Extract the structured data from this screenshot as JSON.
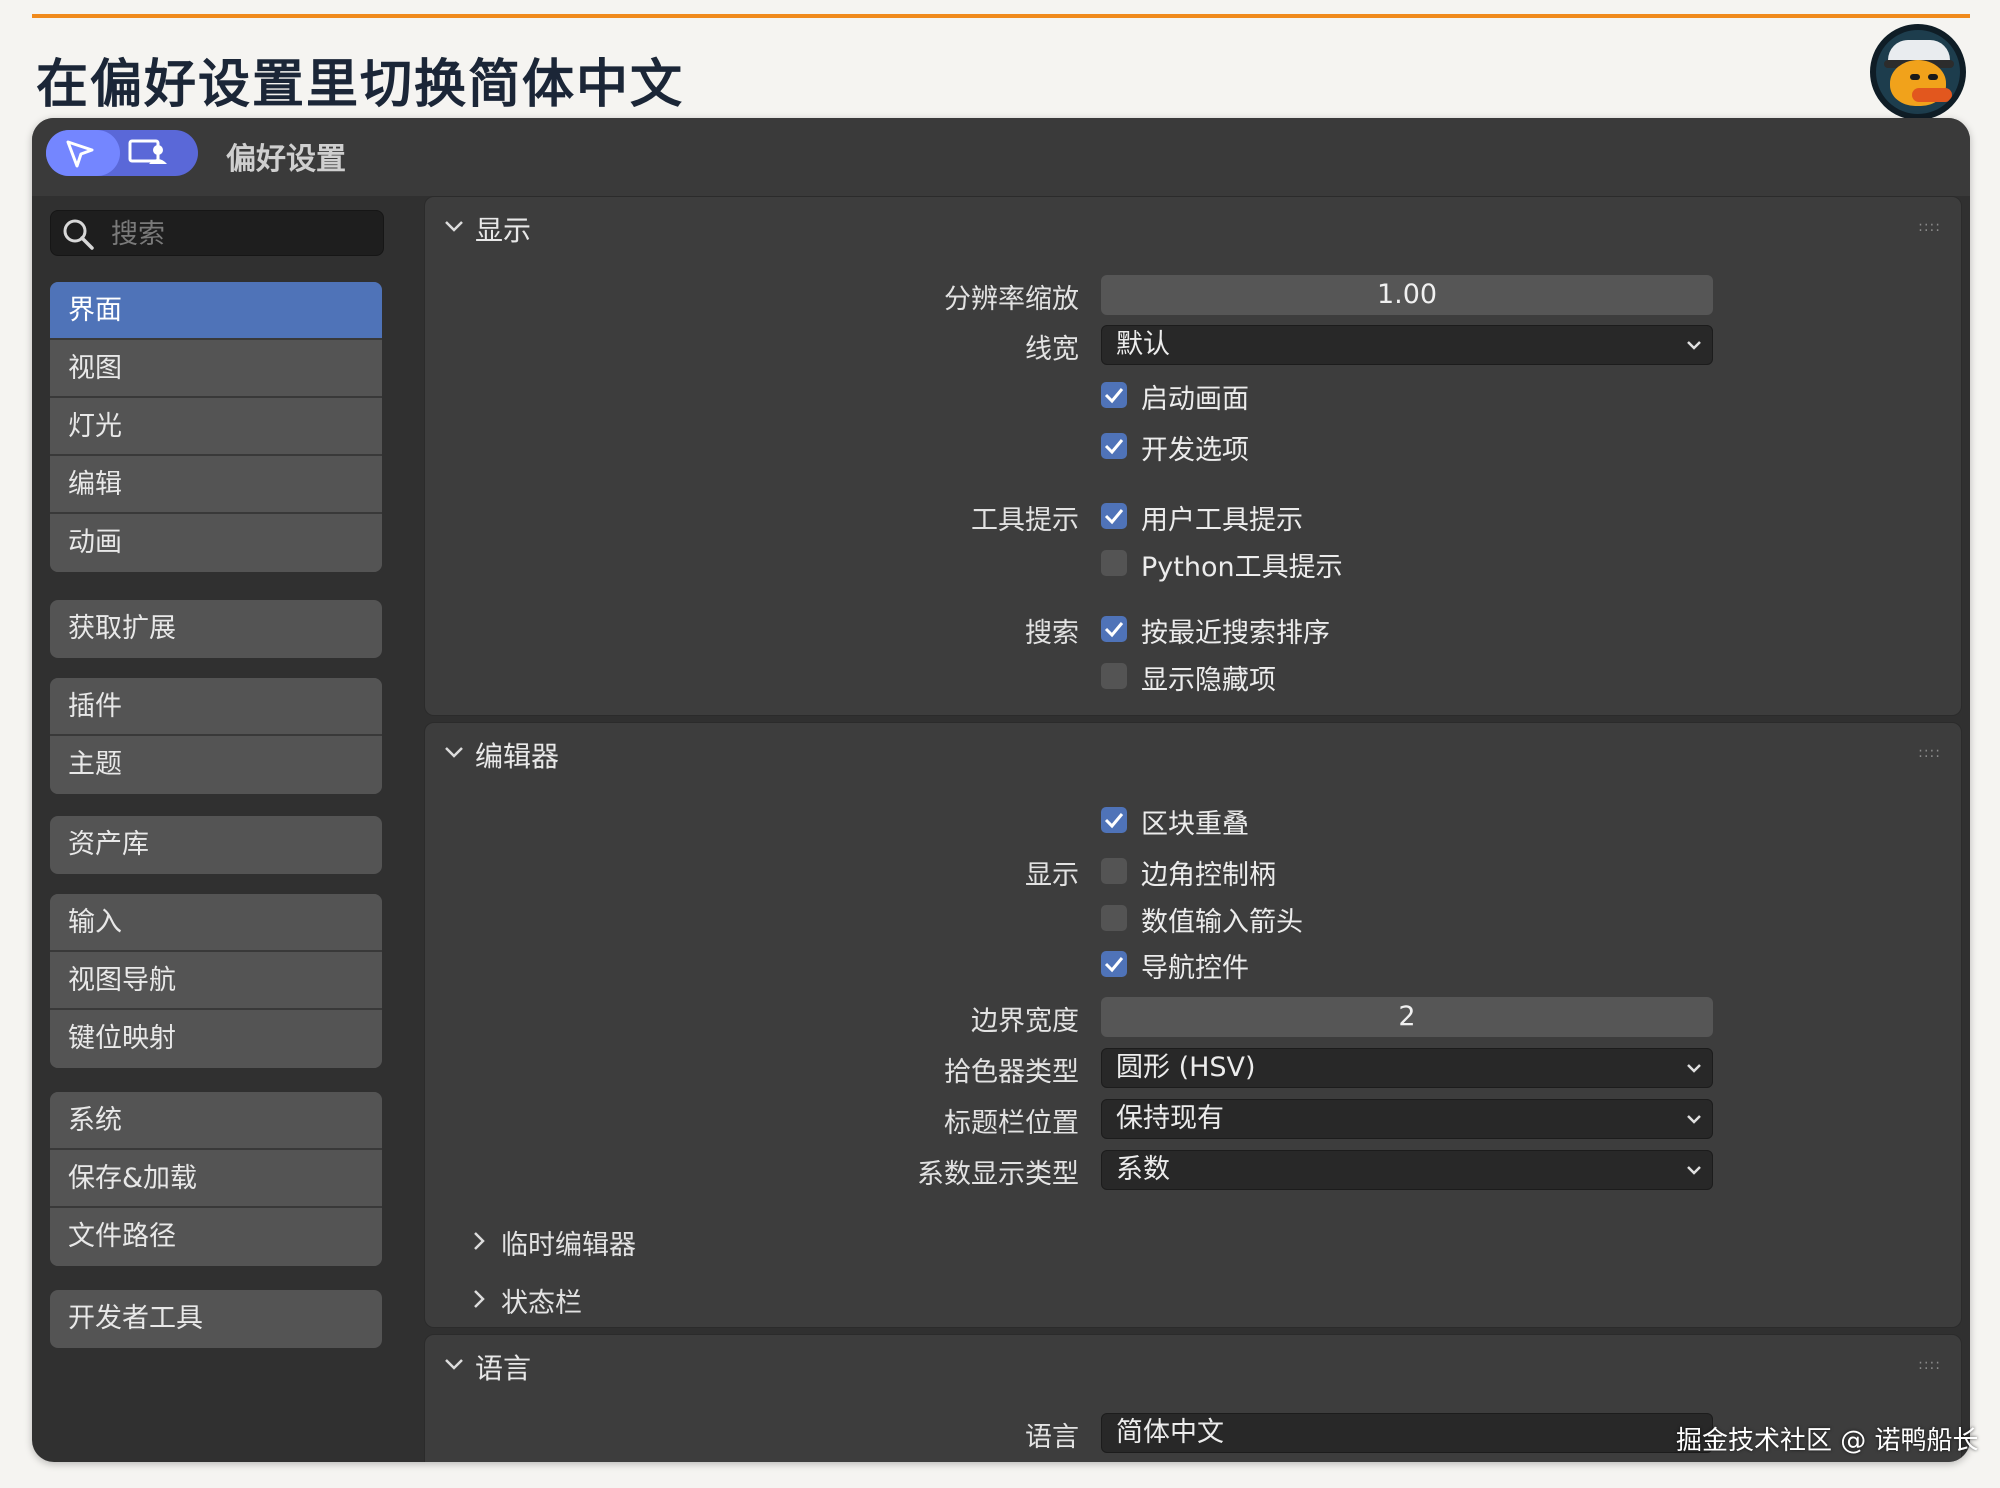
{
  "heading": "在偏好设置里切换简体中文",
  "window": {
    "title": "偏好设置",
    "search_placeholder": "搜索"
  },
  "sidebar": {
    "groups": [
      [
        "界面",
        "视图",
        "灯光",
        "编辑",
        "动画"
      ],
      [
        "获取扩展"
      ],
      [
        "插件",
        "主题"
      ],
      [
        "资产库"
      ],
      [
        "输入",
        "视图导航",
        "键位映射"
      ],
      [
        "系统",
        "保存&加载",
        "文件路径"
      ],
      [
        "开发者工具"
      ]
    ],
    "active": "界面"
  },
  "display_panel": {
    "title": "显示",
    "resolution_scale_label": "分辨率缩放",
    "resolution_scale_value": "1.00",
    "line_width_label": "线宽",
    "line_width_value": "默认",
    "splash_screen": "启动画面",
    "developer_extras": "开发选项",
    "tooltips_label": "工具提示",
    "user_tooltips": "用户工具提示",
    "python_tooltips": "Python工具提示",
    "search_label": "搜索",
    "sort_by_recent": "按最近搜索排序",
    "show_hidden": "显示隐藏项"
  },
  "editors_panel": {
    "title": "编辑器",
    "region_overlap": "区块重叠",
    "display_label": "显示",
    "corner_handles": "边角控制柄",
    "number_arrows": "数值输入箭头",
    "navigation_controls": "导航控件",
    "border_width_label": "边界宽度",
    "border_width_value": "2",
    "color_picker_label": "拾色器类型",
    "color_picker_value": "圆形 (HSV)",
    "header_position_label": "标题栏位置",
    "header_position_value": "保持现有",
    "factor_display_label": "系数显示类型",
    "factor_display_value": "系数",
    "temp_editors": "临时编辑器",
    "status_bar": "状态栏"
  },
  "language_panel": {
    "title": "语言",
    "language_label": "语言",
    "language_value": "简体中文"
  },
  "checkbox_states": {
    "splash_screen": true,
    "developer_extras": true,
    "user_tooltips": true,
    "python_tooltips": false,
    "sort_by_recent": true,
    "show_hidden": false,
    "region_overlap": true,
    "corner_handles": false,
    "number_arrows": false,
    "navigation_controls": true
  },
  "watermark": "掘金技术社区 @ 诺鸭船长",
  "colors": {
    "accent_orange": "#f08a1c",
    "active_blue": "#4f73b8",
    "window_bg": "#303030"
  }
}
